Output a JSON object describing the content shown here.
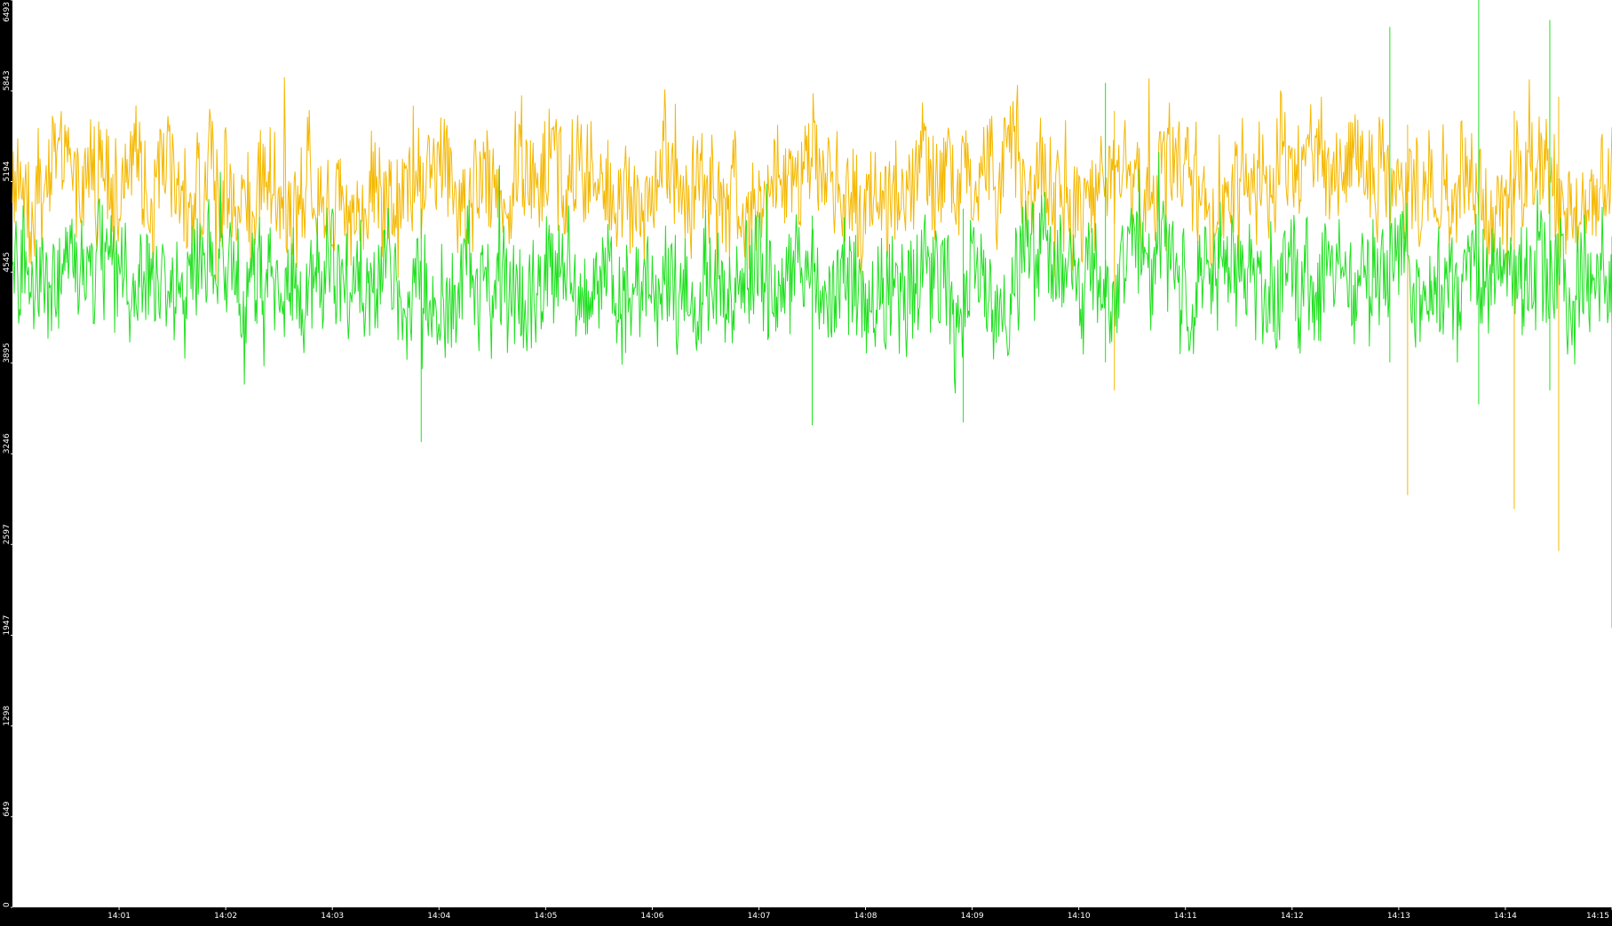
{
  "chart_data": {
    "type": "line",
    "title": "",
    "xlabel": "",
    "ylabel": "",
    "background_color": "#000000",
    "plot_background_color": "#ffffff",
    "axis_text_color": "#ffffff",
    "grid": false,
    "legend": "none",
    "ylim": [
      0,
      6493
    ],
    "xlim": [
      "14:00:00",
      "14:15:00"
    ],
    "y_ticks": [
      "0",
      "649",
      "1298",
      "1947",
      "2597",
      "3246",
      "3895",
      "4545",
      "5194",
      "5843",
      "6493"
    ],
    "x_ticks": [
      "14:01",
      "14:02",
      "14:03",
      "14:04",
      "14:05",
      "14:06",
      "14:07",
      "14:08",
      "14:09",
      "14:10",
      "14:11",
      "14:12",
      "14:13",
      "14:14",
      "14:15"
    ],
    "series": [
      {
        "color": "#f5b800",
        "sample_interval_seconds": 60,
        "values": [
          5190,
          5230,
          5160,
          5080,
          5220,
          5200,
          5150,
          5140,
          5180,
          5210,
          5170,
          5130,
          5260,
          5170,
          5180,
          5150
        ],
        "extremes": [
          {
            "time": "14:10:20",
            "min": 3700,
            "max": 5700
          },
          {
            "time": "14:13:05",
            "min": 2950,
            "max": 5600
          },
          {
            "time": "14:14:05",
            "min": 2850,
            "max": 5700
          },
          {
            "time": "14:14:30",
            "min": 2550,
            "max": 5800
          }
        ]
      },
      {
        "color": "#22e022",
        "sample_interval_seconds": 60,
        "values": [
          4530,
          4500,
          4480,
          4470,
          4460,
          4480,
          4440,
          4510,
          4420,
          4490,
          4570,
          4500,
          4480,
          4520,
          4560,
          4550
        ],
        "extremes": [
          {
            "time": "14:03:50",
            "min": 3330,
            "max": 5000
          },
          {
            "time": "14:07:30",
            "min": 3450,
            "max": 4950
          },
          {
            "time": "14:08:55",
            "min": 3470,
            "max": 5000
          },
          {
            "time": "14:10:15",
            "min": 3900,
            "max": 5900
          },
          {
            "time": "14:12:55",
            "min": 3900,
            "max": 6300
          },
          {
            "time": "14:13:45",
            "min": 3600,
            "max": 6493
          },
          {
            "time": "14:14:25",
            "min": 3700,
            "max": 6350
          },
          {
            "time": "14:15:00",
            "min": 2000,
            "max": 4800
          }
        ]
      }
    ]
  }
}
